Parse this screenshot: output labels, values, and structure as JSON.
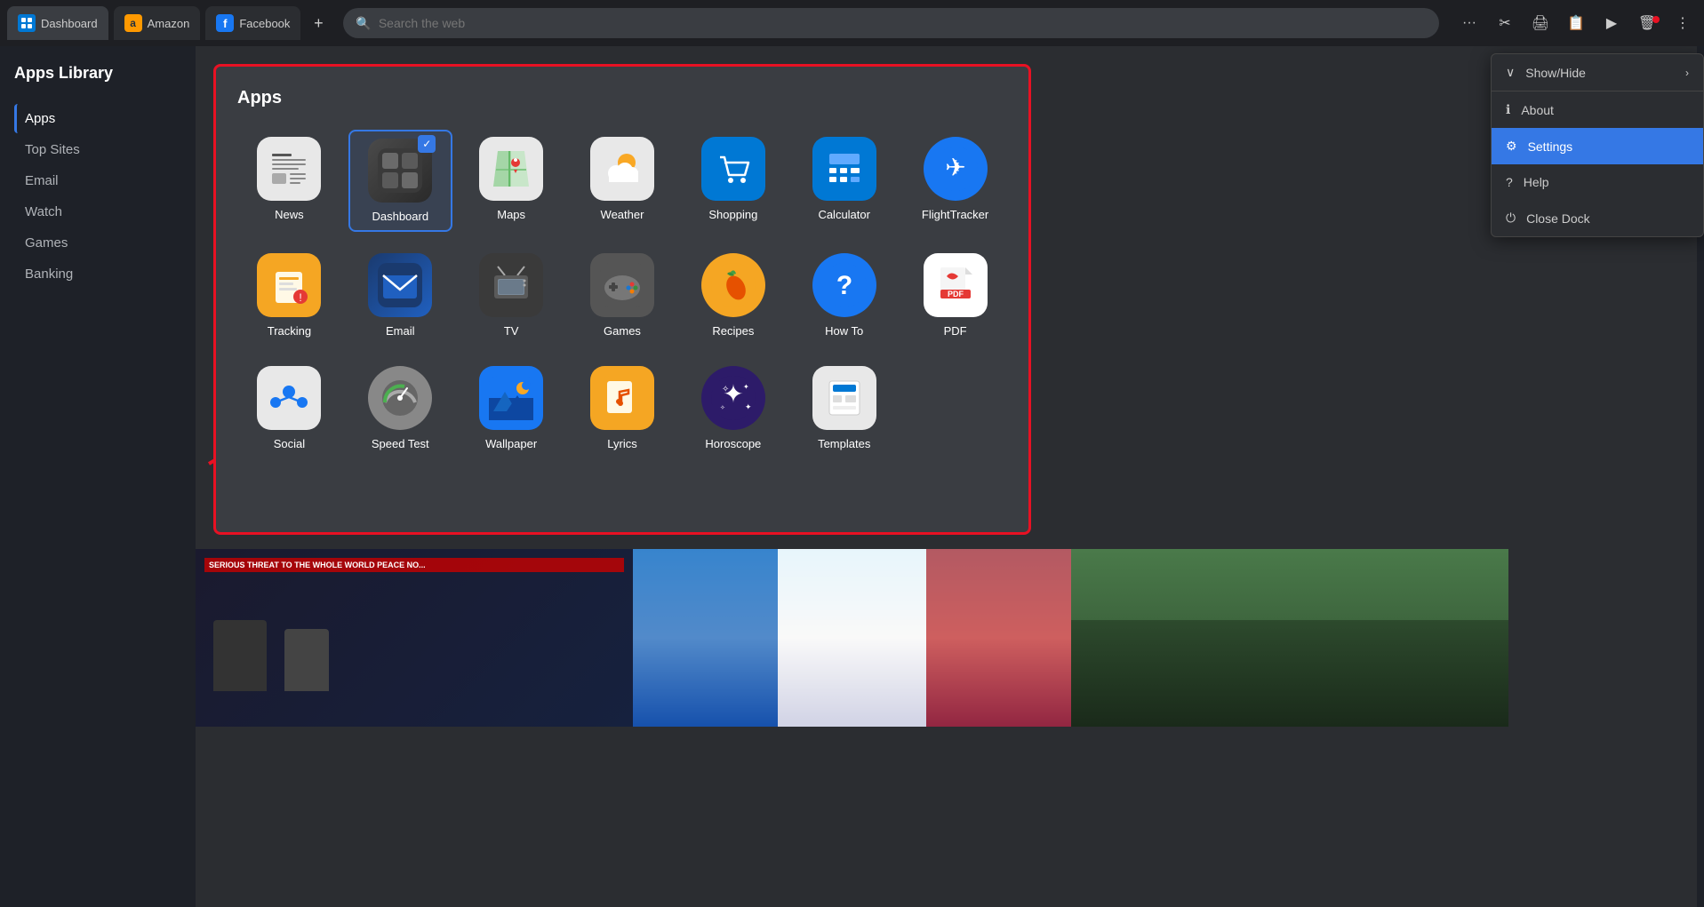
{
  "browser": {
    "tabs": [
      {
        "label": "Dashboard",
        "active": true,
        "icon": "dashboard"
      },
      {
        "label": "Amazon",
        "icon": "amazon"
      },
      {
        "label": "Facebook",
        "icon": "facebook"
      }
    ],
    "new_tab_label": "+",
    "search_placeholder": "Search the web",
    "search_value": ""
  },
  "sidebar": {
    "title": "Apps Library",
    "items": [
      {
        "label": "Apps",
        "active": true
      },
      {
        "label": "Top Sites",
        "active": false
      },
      {
        "label": "Email",
        "active": false
      },
      {
        "label": "Watch",
        "active": false
      },
      {
        "label": "Games",
        "active": false
      },
      {
        "label": "Banking",
        "active": false
      }
    ]
  },
  "apps_panel": {
    "title": "Apps",
    "apps": [
      {
        "id": "news",
        "label": "News",
        "row": 1
      },
      {
        "id": "dashboard",
        "label": "Dashboard",
        "row": 1,
        "selected": true
      },
      {
        "id": "maps",
        "label": "Maps",
        "row": 1
      },
      {
        "id": "weather",
        "label": "Weather",
        "row": 1
      },
      {
        "id": "shopping",
        "label": "Shopping",
        "row": 1
      },
      {
        "id": "calculator",
        "label": "Calculator",
        "row": 1
      },
      {
        "id": "flighttracker",
        "label": "FlightTracker",
        "row": 2
      },
      {
        "id": "tracking",
        "label": "Tracking",
        "row": 2
      },
      {
        "id": "email",
        "label": "Email",
        "row": 2
      },
      {
        "id": "tv",
        "label": "TV",
        "row": 2
      },
      {
        "id": "games",
        "label": "Games",
        "row": 2
      },
      {
        "id": "recipes",
        "label": "Recipes",
        "row": 2
      },
      {
        "id": "howto",
        "label": "How To",
        "row": 2
      },
      {
        "id": "pdf",
        "label": "PDF",
        "row": 3
      },
      {
        "id": "social",
        "label": "Social",
        "row": 3
      },
      {
        "id": "speedtest",
        "label": "Speed Test",
        "row": 3
      },
      {
        "id": "wallpaper",
        "label": "Wallpaper",
        "row": 3
      },
      {
        "id": "lyrics",
        "label": "Lyrics",
        "row": 3
      },
      {
        "id": "horoscope",
        "label": "Horoscope",
        "row": 3
      },
      {
        "id": "templates",
        "label": "Templates",
        "row": 3
      }
    ]
  },
  "dropdown": {
    "items": [
      {
        "id": "show-hide",
        "label": "Show/Hide",
        "has_arrow": true
      },
      {
        "id": "about",
        "label": "About",
        "icon": "ℹ"
      },
      {
        "id": "settings",
        "label": "Settings",
        "icon": "⚙",
        "active": true
      },
      {
        "id": "help",
        "label": "Help",
        "icon": "?"
      },
      {
        "id": "close-dock",
        "label": "Close Dock",
        "icon": "⏻"
      }
    ]
  },
  "news": {
    "headline1": "SERIOUS THREAT TO THE WHOLE WORLD PEACE NO...",
    "headline2": "",
    "headline3": ""
  },
  "icons": {
    "search": "🔍",
    "more": "···",
    "scissors": "✂",
    "print": "🖨",
    "clipboard": "📋",
    "play": "▶",
    "trash": "🗑",
    "menu": "⋮",
    "chevron_right": "›",
    "chevron_down": "∨"
  }
}
